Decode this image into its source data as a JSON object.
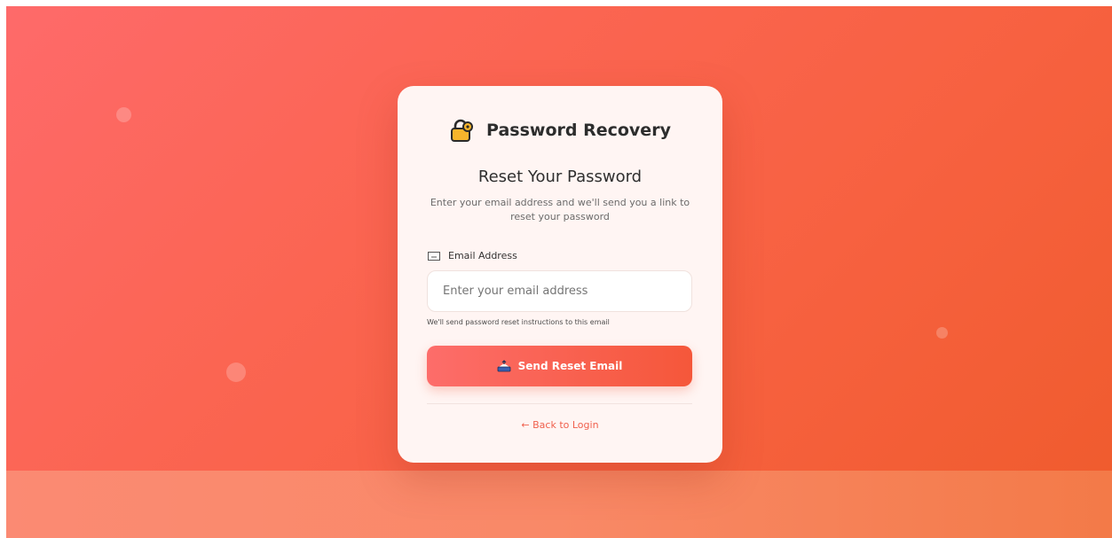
{
  "brand": {
    "title": "Password Recovery",
    "icon": "lock-icon"
  },
  "form": {
    "heading": "Reset Your Password",
    "subtitle": "Enter your email address and we'll send you a link to reset your password",
    "email_label": "Email Address",
    "email_label_icon": "email-icon",
    "email_value": "",
    "email_placeholder": "Enter your email address",
    "email_hint": "We'll send password reset instructions to this email",
    "submit_label": "Send Reset Email",
    "submit_icon": "send-icon"
  },
  "footer": {
    "back_link": "← Back to Login"
  },
  "colors": {
    "accent": "#f5573a",
    "accent_light": "#fd6d6a",
    "link": "#f0604d",
    "card_background": "#fff5f3"
  }
}
